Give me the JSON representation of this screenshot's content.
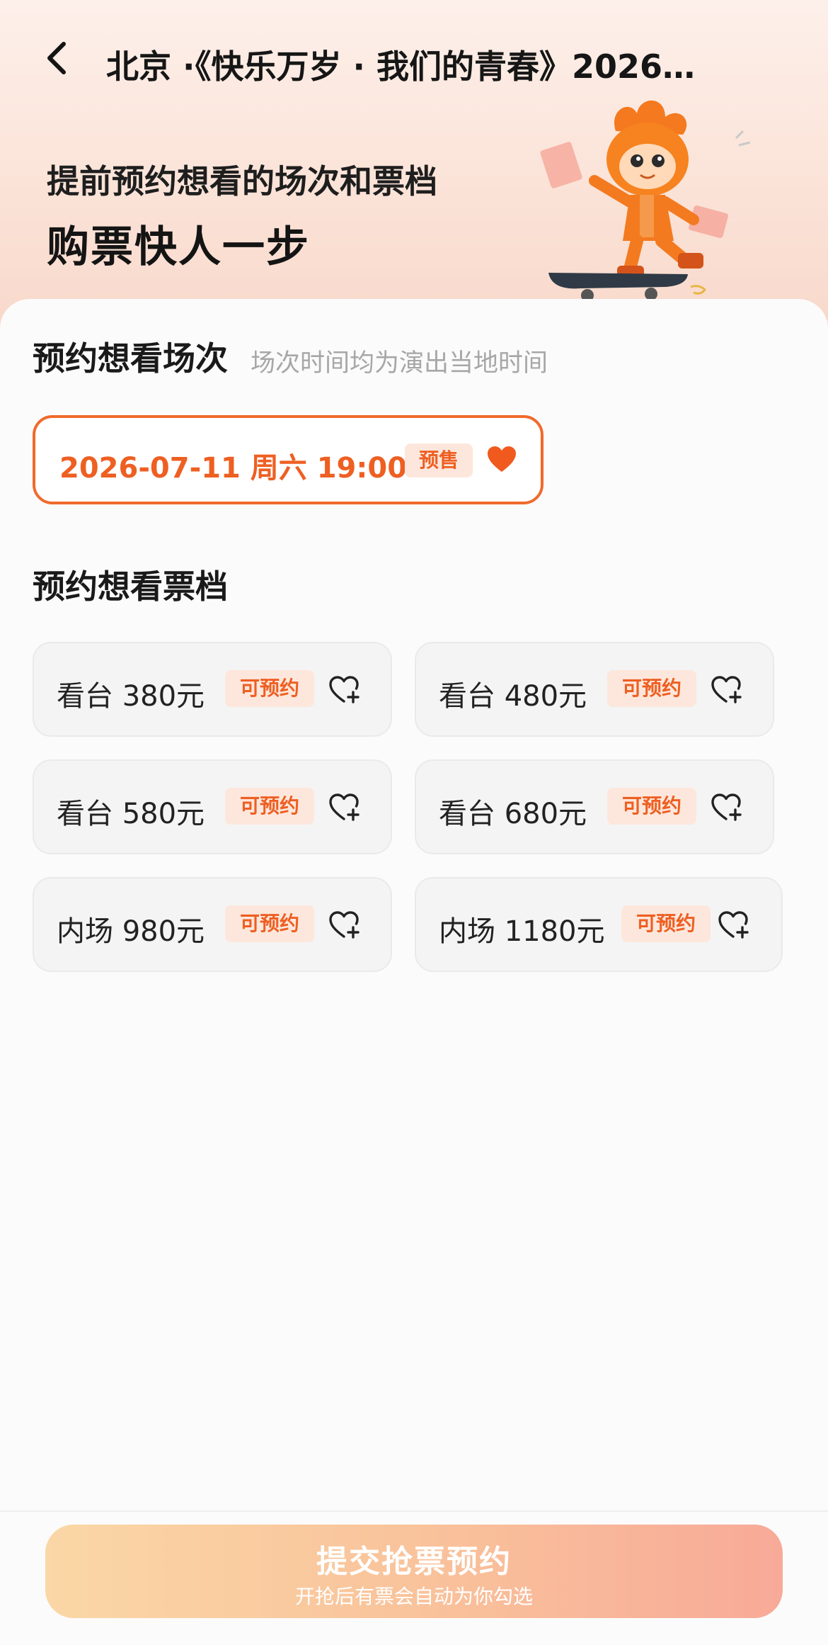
{
  "header": {
    "title": "北京 ·《快乐万岁 · 我们的青春》2026…",
    "back_icon": "chevron-left-icon"
  },
  "hero": {
    "subtitle": "提前预约想看的场次和票档",
    "headline": "购票快人一步",
    "illustration": "skateboard-mascot"
  },
  "sessions_section": {
    "title": "预约想看场次",
    "note": "场次时间均为演出当地时间",
    "sessions": [
      {
        "label": "2026-07-11  周六 19:00",
        "badge": "预售",
        "icon": "heart-filled-icon",
        "selected": true
      }
    ]
  },
  "tiers_section": {
    "title": "预约想看票档",
    "tiers": [
      {
        "name": "看台 380元",
        "badge": "可预约",
        "icon": "heart-plus-icon"
      },
      {
        "name": "看台 480元",
        "badge": "可预约",
        "icon": "heart-plus-icon"
      },
      {
        "name": "看台 580元",
        "badge": "可预约",
        "icon": "heart-plus-icon"
      },
      {
        "name": "看台 680元",
        "badge": "可预约",
        "icon": "heart-plus-icon"
      },
      {
        "name": "内场 980元",
        "badge": "可预约",
        "icon": "heart-plus-icon"
      },
      {
        "name": "内场 1180元",
        "badge": "可预约",
        "icon": "heart-plus-icon"
      }
    ]
  },
  "footer": {
    "submit_label": "提交抢票预约",
    "submit_sub": "开抢后有票会自动为你勾选"
  },
  "colors": {
    "accent": "#ee5f22",
    "badge_bg": "#fde7dc",
    "tier_bg": "#f4f4f4"
  }
}
